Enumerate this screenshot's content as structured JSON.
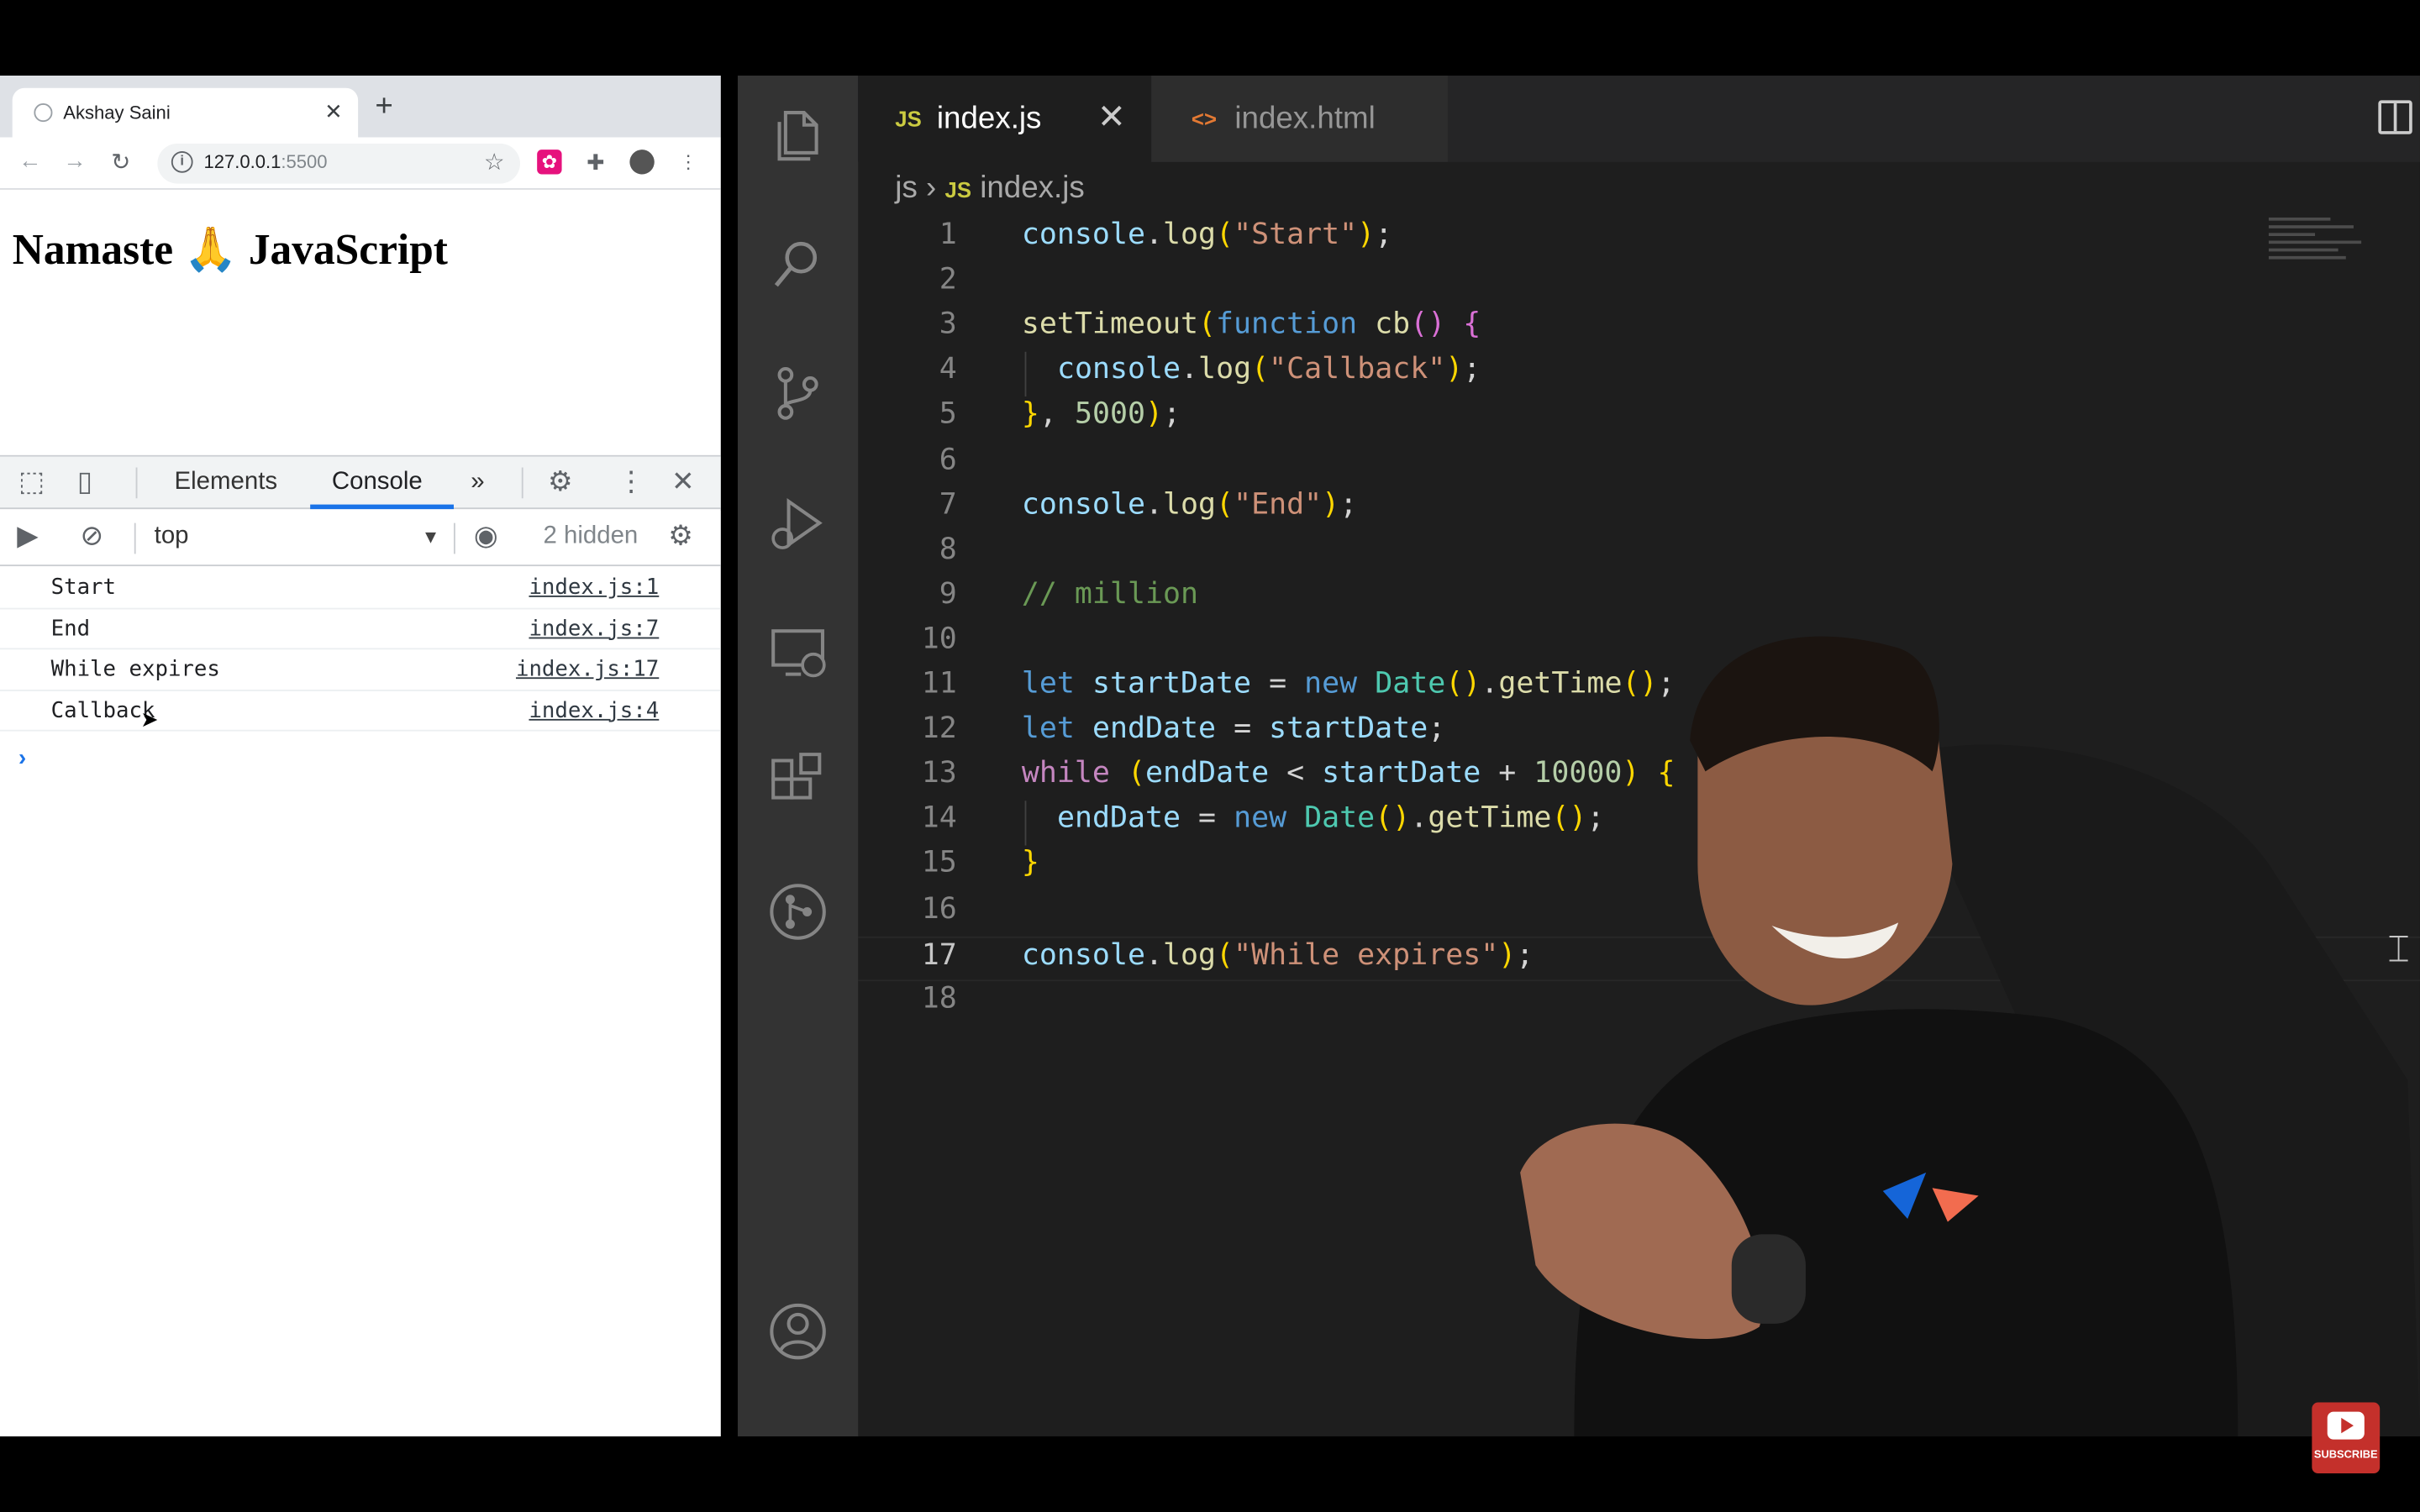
{
  "browser": {
    "tab_title": "Akshay Saini",
    "new_tab": "+",
    "url_host": "127.0.0.1",
    "url_port": ":5500",
    "page_heading": "Namaste 🙏 JavaScript"
  },
  "devtools": {
    "tabs": [
      "Elements",
      "Console"
    ],
    "more_tabs": "»",
    "context": "top",
    "hidden_count": "2 hidden",
    "console_rows": [
      {
        "message": "Start",
        "source": "index.js:1"
      },
      {
        "message": "End",
        "source": "index.js:7"
      },
      {
        "message": "While expires",
        "source": "index.js:17"
      },
      {
        "message": "Callback",
        "source": "index.js:4"
      }
    ],
    "prompt": "›"
  },
  "vscode": {
    "tabs": [
      {
        "icon": "JS",
        "label": "index.js",
        "active": true
      },
      {
        "icon": "<>",
        "label": "index.html",
        "active": false
      }
    ],
    "breadcrumb": {
      "folder": "js",
      "separator": "›",
      "file_icon": "JS",
      "file": "index.js"
    },
    "current_line": 17,
    "lines": [
      "console.log(\"Start\");",
      "",
      "setTimeout(function cb() {",
      "  console.log(\"Callback\");",
      "}, 5000);",
      "",
      "console.log(\"End\");",
      "",
      "// million",
      "",
      "let startDate = new Date().getTime();",
      "let endDate = startDate;",
      "while (endDate < startDate + 10000) {",
      "  endDate = new Date().getTime();",
      "}",
      "",
      "console.log(\"While expires\");",
      ""
    ]
  },
  "youtube": {
    "subscribe": "SUBSCRIBE"
  },
  "colors": {
    "vscode_bg": "#1e1e1e",
    "activity_bar": "#333333",
    "devtools_accent": "#1a73e8",
    "js_icon": "#cbcb41",
    "html_icon": "#e37933"
  }
}
